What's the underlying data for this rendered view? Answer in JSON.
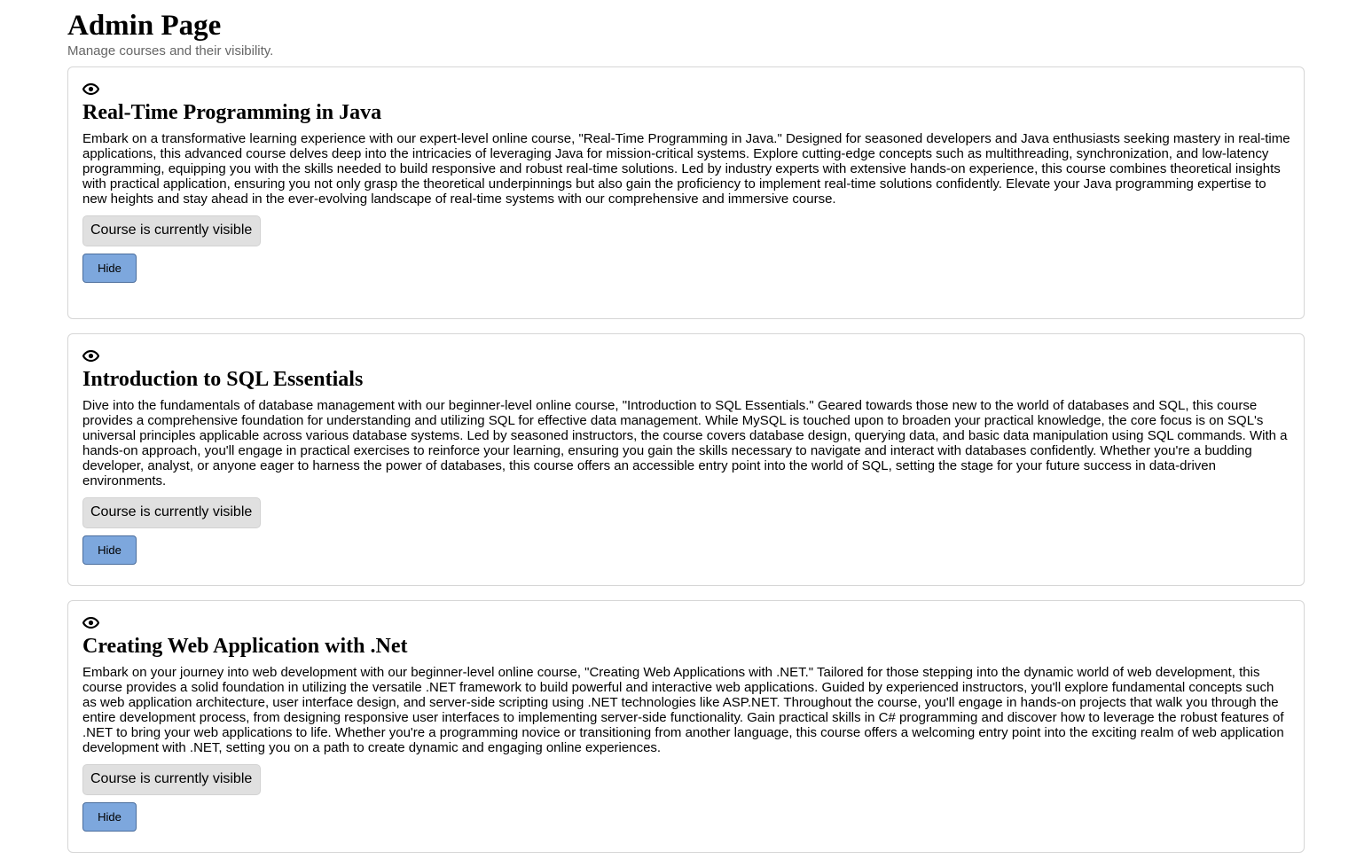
{
  "header": {
    "title": "Admin Page",
    "subtitle": "Manage courses and their visibility."
  },
  "courses": [
    {
      "icon": "eye-icon",
      "title": "Real-Time Programming in Java",
      "description": "Embark on a transformative learning experience with our expert-level online course, \"Real-Time Programming in Java.\" Designed for seasoned developers and Java enthusiasts seeking mastery in real-time applications, this advanced course delves deep into the intricacies of leveraging Java for mission-critical systems. Explore cutting-edge concepts such as multithreading, synchronization, and low-latency programming, equipping you with the skills needed to build responsive and robust real-time solutions. Led by industry experts with extensive hands-on experience, this course combines theoretical insights with practical application, ensuring you not only grasp the theoretical underpinnings but also gain the proficiency to implement real-time solutions confidently. Elevate your Java programming expertise to new heights and stay ahead in the ever-evolving landscape of real-time systems with our comprehensive and immersive course.",
      "status": "Course is currently visible",
      "button_label": "Hide"
    },
    {
      "icon": "eye-icon",
      "title": "Introduction to SQL Essentials",
      "description": "Dive into the fundamentals of database management with our beginner-level online course, \"Introduction to SQL Essentials.\" Geared towards those new to the world of databases and SQL, this course provides a comprehensive foundation for understanding and utilizing SQL for effective data management. While MySQL is touched upon to broaden your practical knowledge, the core focus is on SQL's universal principles applicable across various database systems. Led by seasoned instructors, the course covers database design, querying data, and basic data manipulation using SQL commands. With a hands-on approach, you'll engage in practical exercises to reinforce your learning, ensuring you gain the skills necessary to navigate and interact with databases confidently. Whether you're a budding developer, analyst, or anyone eager to harness the power of databases, this course offers an accessible entry point into the world of SQL, setting the stage for your future success in data-driven environments.",
      "status": "Course is currently visible",
      "button_label": "Hide"
    },
    {
      "icon": "eye-icon",
      "title": "Creating Web Application with .Net",
      "description": "Embark on your journey into web development with our beginner-level online course, \"Creating Web Applications with .NET.\" Tailored for those stepping into the dynamic world of web development, this course provides a solid foundation in utilizing the versatile .NET framework to build powerful and interactive web applications. Guided by experienced instructors, you'll explore fundamental concepts such as web application architecture, user interface design, and server-side scripting using .NET technologies like ASP.NET. Throughout the course, you'll engage in hands-on projects that walk you through the entire development process, from designing responsive user interfaces to implementing server-side functionality. Gain practical skills in C# programming and discover how to leverage the robust features of .NET to bring your web applications to life. Whether you're a programming novice or transitioning from another language, this course offers a welcoming entry point into the exciting realm of web application development with .NET, setting you on a path to create dynamic and engaging online experiences.",
      "status": "Course is currently visible",
      "button_label": "Hide"
    }
  ],
  "colors": {
    "button_bg": "#7da7dd",
    "button_border": "#4a6d9c",
    "status_bg": "#e0e0e0",
    "card_border": "#d6d6d6",
    "subtitle_text": "#666666"
  }
}
